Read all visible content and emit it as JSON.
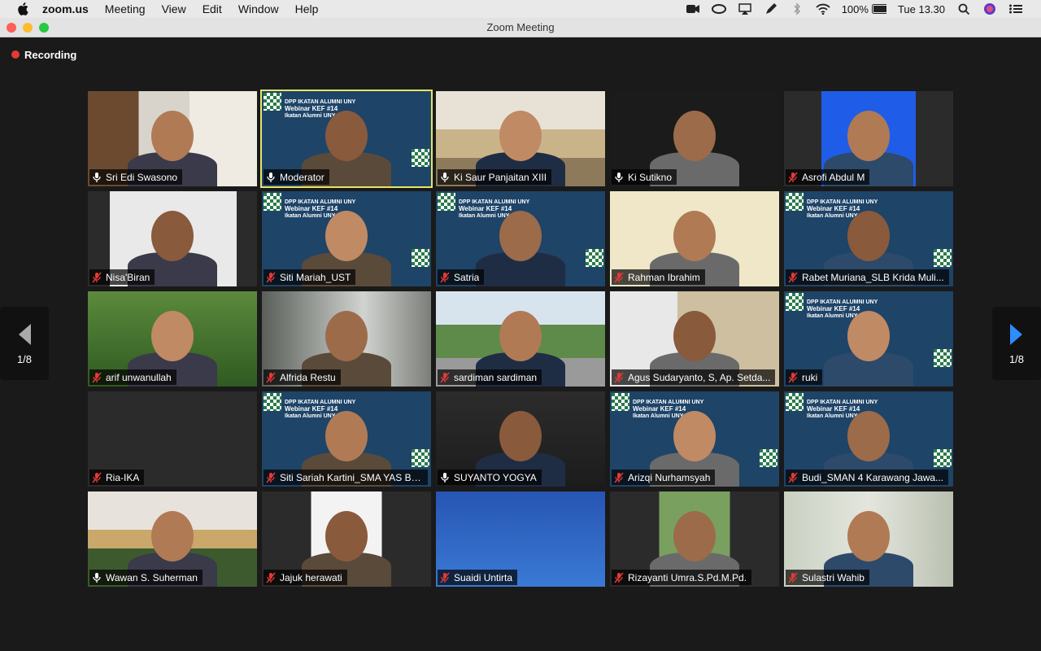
{
  "menubar": {
    "app": "zoom.us",
    "items": [
      "Meeting",
      "View",
      "Edit",
      "Window",
      "Help"
    ],
    "battery": "100%",
    "clock": "Tue 13.30"
  },
  "window": {
    "title": "Zoom Meeting"
  },
  "recording": {
    "label": "Recording"
  },
  "pager": {
    "left": "1/8",
    "right": "1/8"
  },
  "participants": [
    {
      "name": "Sri Edi Swasono",
      "muted": false,
      "scene": "room"
    },
    {
      "name": "Moderator",
      "muted": false,
      "scene": "webinar",
      "active": true
    },
    {
      "name": "Ki Saur Panjaitan XIII",
      "muted": false,
      "scene": "hall"
    },
    {
      "name": "Ki Sutikno",
      "muted": false,
      "scene": "dark"
    },
    {
      "name": "Asrofi Abdul M",
      "muted": true,
      "scene": "blue"
    },
    {
      "name": "Nisa'Biran",
      "muted": true,
      "scene": "white"
    },
    {
      "name": "Siti Mariah_UST",
      "muted": true,
      "scene": "webinar"
    },
    {
      "name": "Satria",
      "muted": true,
      "scene": "webinar"
    },
    {
      "name": "Rahman Ibrahim",
      "muted": true,
      "scene": "cream"
    },
    {
      "name": "Rabet Muriana_SLB Krida Muli...",
      "muted": true,
      "scene": "webinar"
    },
    {
      "name": "arif unwanullah",
      "muted": true,
      "scene": "green"
    },
    {
      "name": "Alfrida Restu",
      "muted": true,
      "scene": "gray"
    },
    {
      "name": "sardiman sardiman",
      "muted": true,
      "scene": "campus"
    },
    {
      "name": "Agus Sudaryanto, S, Ap. Setda...",
      "muted": true,
      "scene": "office"
    },
    {
      "name": "ruki",
      "muted": true,
      "scene": "webinar"
    },
    {
      "name": "Ria-IKA",
      "muted": true,
      "scene": "empty"
    },
    {
      "name": "Siti Sariah Kartini_SMA YAS Ba...",
      "muted": true,
      "scene": "webinar"
    },
    {
      "name": "SUYANTO YOGYA",
      "muted": false,
      "scene": "darkroom"
    },
    {
      "name": "Arizqi Nurhamsyah",
      "muted": true,
      "scene": "webinar"
    },
    {
      "name": "Budi_SMAN 4 Karawang Jawa...",
      "muted": true,
      "scene": "webinar"
    },
    {
      "name": "Wawan S. Suherman",
      "muted": false,
      "scene": "building"
    },
    {
      "name": "Jajuk herawati",
      "muted": true,
      "scene": "white2"
    },
    {
      "name": "Suaidi Untirta",
      "muted": true,
      "scene": "poster"
    },
    {
      "name": "Rizayanti Umra.S.Pd.M.Pd.",
      "muted": true,
      "scene": "garden"
    },
    {
      "name": "Sulastri Wahib",
      "muted": true,
      "scene": "blur"
    }
  ],
  "webinar_text": {
    "org": "DPP IKATAN ALUMNI UNY",
    "title": "Webinar KEF #14",
    "subtitle": "Ikatan Alumni UNY"
  },
  "colors": {
    "accent_active": "#e5e566",
    "muted_mic": "#e53935",
    "webinar_bg": "#1e4468"
  }
}
